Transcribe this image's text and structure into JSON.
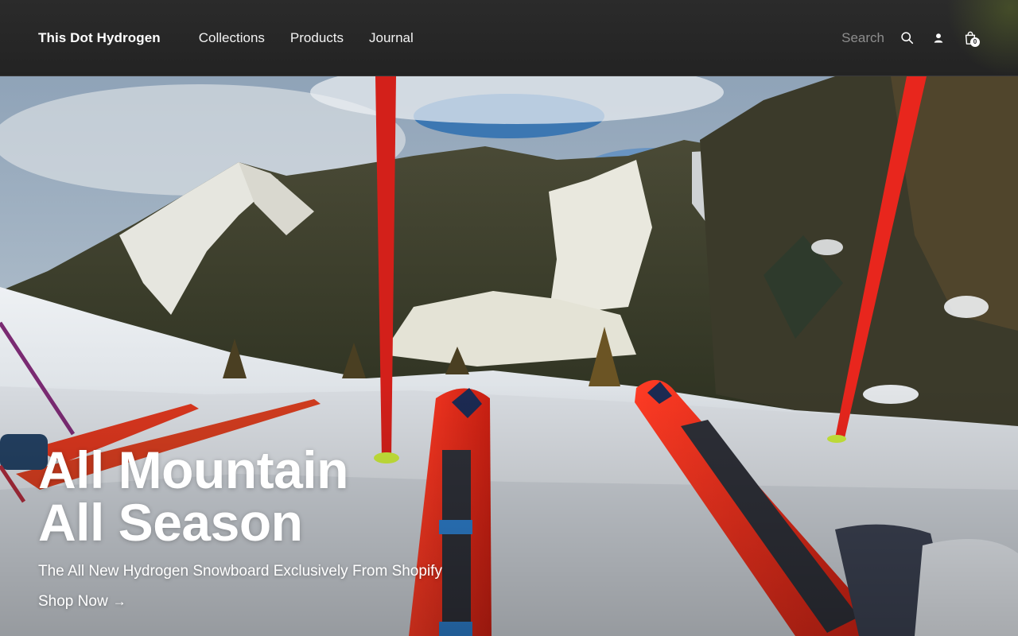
{
  "header": {
    "brand": "This Dot Hydrogen",
    "nav": [
      {
        "label": "Collections"
      },
      {
        "label": "Products"
      },
      {
        "label": "Journal"
      }
    ],
    "search": {
      "placeholder": "Search"
    },
    "icons": {
      "search": "search-icon",
      "account": "user-icon",
      "cart": "shopping-bag-icon"
    },
    "cart_count": "0"
  },
  "hero": {
    "title_line1": "All Mountain",
    "title_line2": "All Season",
    "subtitle": "The All New Hydrogen Snowboard Exclusively From Shopify",
    "cta_label": "Shop Now",
    "cta_arrow": "→",
    "image": "ski-slope-photo"
  },
  "colors": {
    "header_bg": "#2b2b2b",
    "text": "#ffffff",
    "muted": "#8d8d8d",
    "ski_red": "#e4261c"
  }
}
